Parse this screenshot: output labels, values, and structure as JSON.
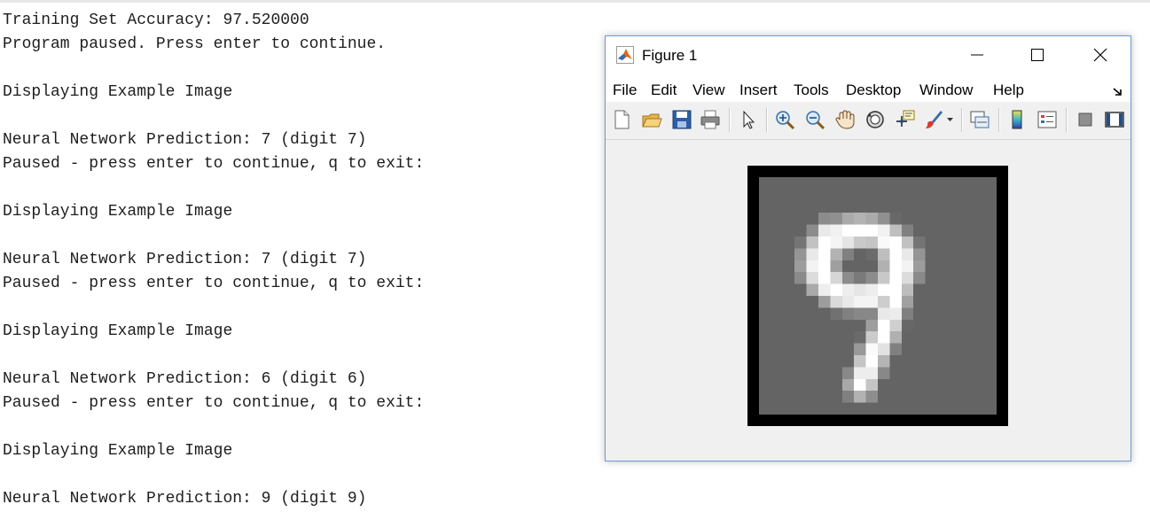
{
  "console": {
    "lines": [
      "Training Set Accuracy: 97.520000",
      "Program paused. Press enter to continue.",
      "",
      "Displaying Example Image",
      "",
      "Neural Network Prediction: 7 (digit 7)",
      "Paused - press enter to continue, q to exit:",
      "",
      "Displaying Example Image",
      "",
      "Neural Network Prediction: 7 (digit 7)",
      "Paused - press enter to continue, q to exit:",
      "",
      "Displaying Example Image",
      "",
      "Neural Network Prediction: 6 (digit 6)",
      "Paused - press enter to continue, q to exit:",
      "",
      "Displaying Example Image",
      "",
      "Neural Network Prediction: 9 (digit 9)"
    ]
  },
  "figure": {
    "title": "Figure 1",
    "app_icon": "matlab-icon",
    "window_controls": [
      "minimize-icon",
      "maximize-icon",
      "close-icon"
    ],
    "menu": [
      "File",
      "Edit",
      "View",
      "Insert",
      "Tools",
      "Desktop",
      "Window",
      "Help"
    ],
    "toolbar": [
      "new-figure-icon",
      "open-file-icon",
      "save-icon",
      "print-icon",
      "select-arrow-icon",
      "zoom-in-icon",
      "zoom-out-icon",
      "pan-hand-icon",
      "rotate-3d-icon",
      "data-cursor-icon",
      "brush-icon",
      "link-plot-icon",
      "insert-colorbar-icon",
      "insert-legend-icon",
      "hide-plot-tools-icon",
      "show-plot-tools-icon"
    ],
    "image": {
      "content": "handwritten digit 9",
      "grid_size": 20,
      "background_color": "#808080",
      "frame_color": "#000000"
    }
  }
}
